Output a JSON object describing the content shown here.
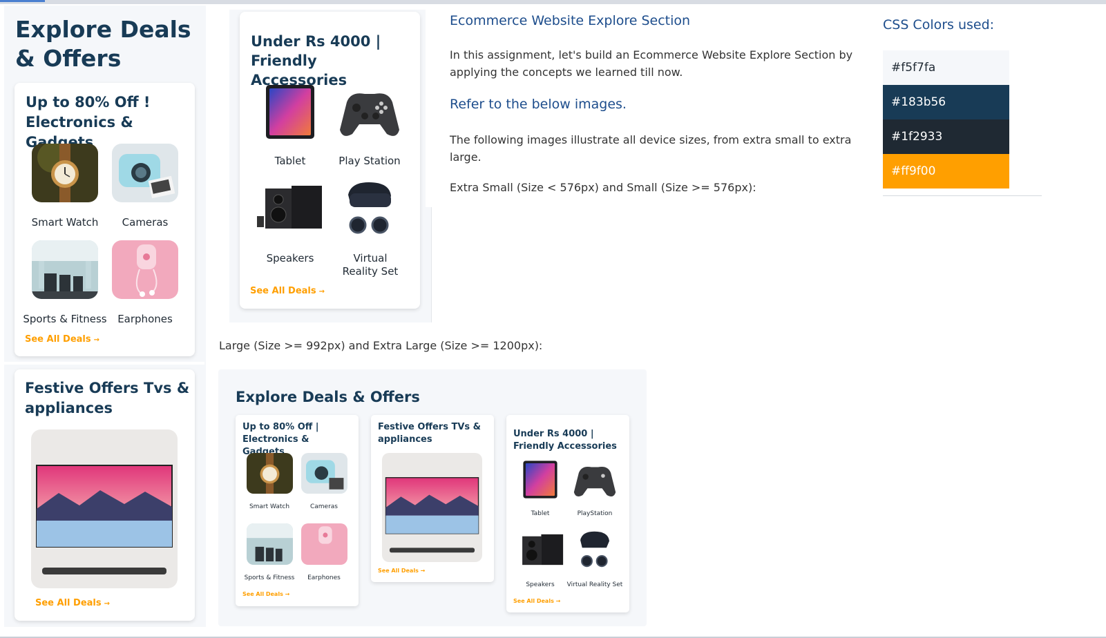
{
  "mobile": {
    "title": "Explore Deals & Offers",
    "card1": {
      "title": "Up to 80% Off ! Electronics & Gadgets",
      "items": [
        "Smart Watch",
        "Cameras",
        "Sports & Fitness",
        "Earphones"
      ],
      "link": "See All Deals"
    },
    "card2": {
      "title": "Festive Offers Tvs & appliances",
      "link": "See All Deals"
    },
    "card3": {
      "title": "Under Rs 4000 | Friendly Accessories",
      "items": [
        "Tablet",
        "Play Station",
        "Speakers",
        "Virtual Reality Set"
      ],
      "link": "See All Deals"
    }
  },
  "instructions": {
    "heading": "Ecommerce Website Explore Section",
    "intro": "In this assignment, let's build an Ecommerce Website Explore Section by applying the concepts we learned till now.",
    "refer": "Refer to the below images.",
    "devices": "The following images illustrate all device sizes, from extra small to extra large.",
    "small_caption": "Extra Small (Size < 576px) and Small (Size >= 576px):",
    "large_caption": "Large (Size >= 992px) and Extra Large (Size >= 1200px):"
  },
  "colors": {
    "heading": "CSS Colors used:",
    "swatches": [
      "#f5f7fa",
      "#183b56",
      "#1f2933",
      "#ff9f00"
    ]
  },
  "desktop": {
    "title": "Explore Deals & Offers",
    "card1": {
      "title": "Up to 80% Off | Electronics & Gadgets",
      "items": [
        "Smart Watch",
        "Cameras",
        "Sports & Fitness",
        "Earphones"
      ],
      "link": "See All Deals"
    },
    "card2": {
      "title": "Festive Offers TVs & appliances",
      "link": "See All Deals"
    },
    "card3": {
      "title": "Under Rs 4000 | Friendly Accessories",
      "items": [
        "Tablet",
        "PlayStation",
        "Speakers",
        "Virtual Reality Set"
      ],
      "link": "See All Deals"
    }
  }
}
